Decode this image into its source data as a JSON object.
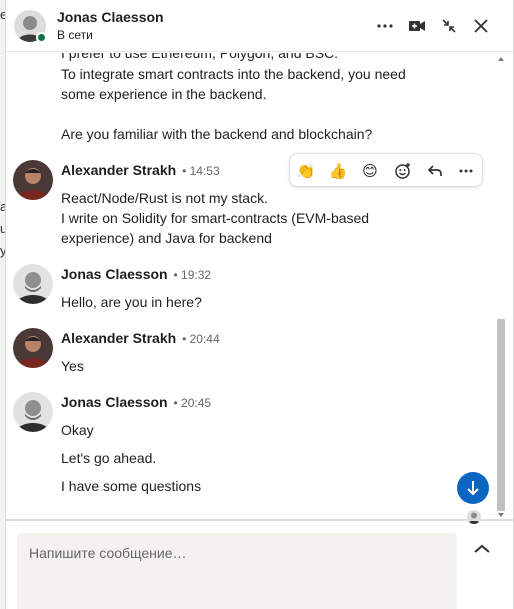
{
  "header": {
    "name": "Jonas Claesson",
    "status": "В сети",
    "buttons": [
      "more-icon",
      "video-call-icon",
      "minimize-icon",
      "close-icon"
    ]
  },
  "background_fragments": [
    "e",
    "a",
    "u",
    "y"
  ],
  "messages": {
    "prev_lines": [
      "I prefer to use Ethereum, Polygon, and BSC.",
      "To integrate smart contracts into the backend, you need",
      "some experience in the backend.",
      "",
      "Are you familiar with the backend and blockchain?"
    ],
    "groups": [
      {
        "sender": "Alexander Strakh",
        "time": "• 14:53",
        "lines": [
          "React/Node/Rust is not my stack.",
          "I write on Solidity for smart-contracts (EVM-based",
          "experience) and Java for backend"
        ]
      },
      {
        "sender": "Jonas Claesson",
        "time": "• 19:32",
        "lines": [
          "Hello, are you in here?"
        ]
      },
      {
        "sender": "Alexander Strakh",
        "time": "• 20:44",
        "lines": [
          "Yes"
        ]
      },
      {
        "sender": "Jonas Claesson",
        "time": "• 20:45",
        "lines": [
          "Okay",
          "Let's go ahead.",
          "I have some questions"
        ]
      }
    ]
  },
  "reactions": {
    "items": [
      "👏",
      "👍",
      "😊"
    ],
    "icons": [
      "add-reaction-icon",
      "reply-icon",
      "more-icon"
    ]
  },
  "composer": {
    "placeholder": "Напишите сообщение…"
  },
  "colors": {
    "accent": "#0a66c2",
    "online": "#057642",
    "composer_bg": "#f4f2ee"
  }
}
